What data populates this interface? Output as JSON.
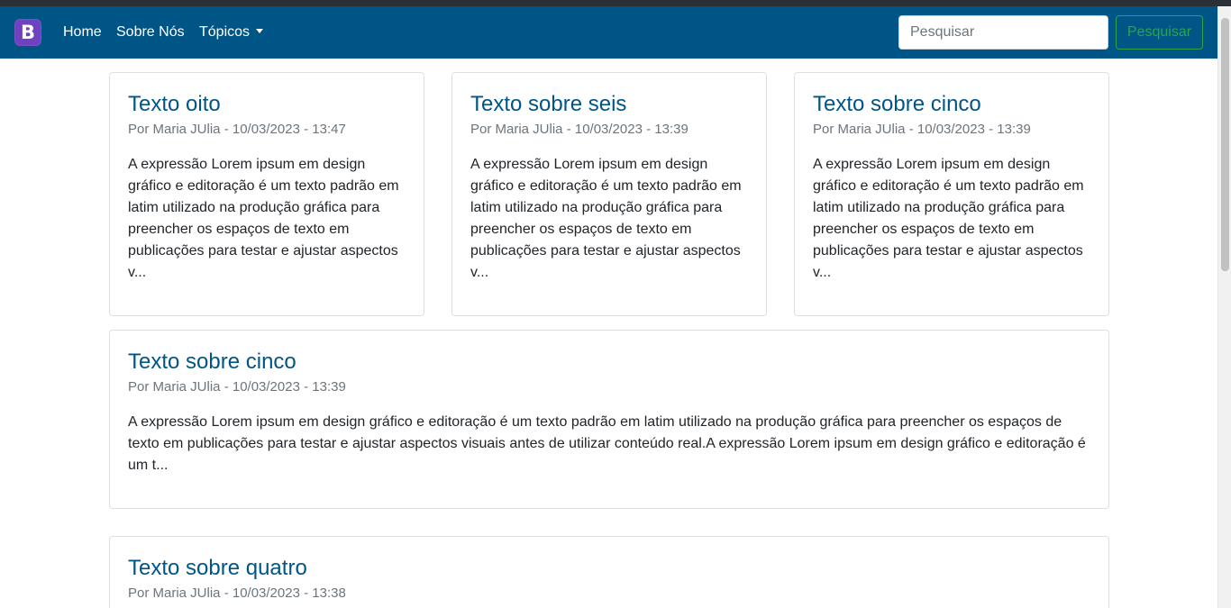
{
  "navbar": {
    "brand_letter": "B",
    "links": [
      "Home",
      "Sobre Nós",
      "Tópicos"
    ],
    "search": {
      "placeholder": "Pesquisar",
      "value": ""
    },
    "search_button": "Pesquisar",
    "colors": {
      "navbar_bg": "#005587",
      "brand_bg": "#6f42c1",
      "search_button": "#28a745"
    }
  },
  "posts": [
    {
      "title": "Texto oito",
      "meta": "Por Maria JUlia - 10/03/2023 - 13:47",
      "excerpt": "A expressão Lorem ipsum em design gráfico e editoração é um texto padrão em latim utilizado na produção gráfica para preencher os espaços de texto em publicações para testar e ajustar aspectos v..."
    },
    {
      "title": "Texto sobre seis",
      "meta": "Por Maria JUlia - 10/03/2023 - 13:39",
      "excerpt": "A expressão Lorem ipsum em design gráfico e editoração é um texto padrão em latim utilizado na produção gráfica para preencher os espaços de texto em publicações para testar e ajustar aspectos v..."
    },
    {
      "title": "Texto sobre cinco",
      "meta": "Por Maria JUlia - 10/03/2023 - 13:39",
      "excerpt": "A expressão Lorem ipsum em design gráfico e editoração é um texto padrão em latim utilizado na produção gráfica para preencher os espaços de texto em publicações para testar e ajustar aspectos v..."
    },
    {
      "title": "Texto sobre cinco",
      "meta": "Por Maria JUlia - 10/03/2023 - 13:39",
      "excerpt": "A expressão Lorem ipsum em design gráfico e editoração é um texto padrão em latim utilizado na produção gráfica para preencher os espaços de texto em publicações para testar e ajustar aspectos visuais antes de utilizar conteúdo real.A expressão Lorem ipsum em design gráfico e editoração é um t..."
    },
    {
      "title": "Texto sobre quatro",
      "meta": "Por Maria JUlia - 10/03/2023 - 13:38",
      "excerpt": ""
    }
  ]
}
